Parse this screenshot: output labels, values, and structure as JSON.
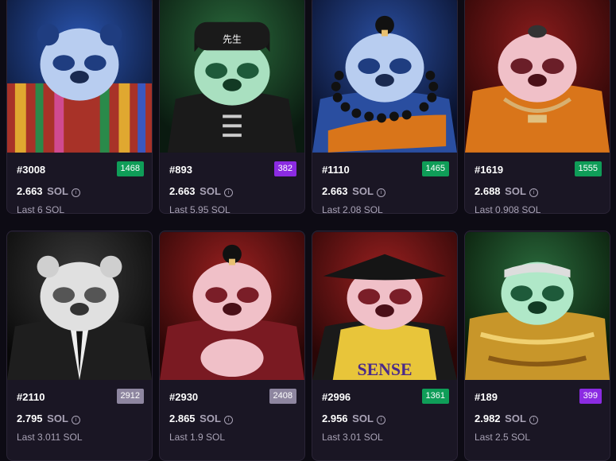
{
  "cards": [
    {
      "id": "#3008",
      "rank": "1468",
      "rank_color": "#0f9d58",
      "price": "2.663",
      "unit": "SOL",
      "last": "Last 6 SOL",
      "bg": "#1b3a7a",
      "fur": "#b8cdf0",
      "patch": "#1f3d80",
      "outfit": "#c0392b"
    },
    {
      "id": "#893",
      "rank": "382",
      "rank_color": "#8b2be2",
      "price": "2.663",
      "unit": "SOL",
      "last": "Last 5.95 SOL",
      "bg": "#1e4d2b",
      "fur": "#a9e0c0",
      "patch": "#1e5a3a",
      "outfit": "#1a1a1a"
    },
    {
      "id": "#1110",
      "rank": "1465",
      "rank_color": "#0f9d58",
      "price": "2.663",
      "unit": "SOL",
      "last": "Last 2.08 SOL",
      "bg": "#18306a",
      "fur": "#b8cdf0",
      "patch": "#1f3d80",
      "outfit": "#2a4ea0"
    },
    {
      "id": "#1619",
      "rank": "1555",
      "rank_color": "#0f9d58",
      "price": "2.688",
      "unit": "SOL",
      "last": "Last 0.908 SOL",
      "bg": "#5a1414",
      "fur": "#f0c0c8",
      "patch": "#6a1e28",
      "outfit": "#d9751a"
    },
    {
      "id": "#2110",
      "rank": "2912",
      "rank_color": "#8e86a0",
      "price": "2.795",
      "unit": "SOL",
      "last": "Last 3.011 SOL",
      "bg": "#2a2a2a",
      "fur": "#e0e0e0",
      "patch": "#555555",
      "outfit": "#222222"
    },
    {
      "id": "#2930",
      "rank": "2408",
      "rank_color": "#8e86a0",
      "price": "2.865",
      "unit": "SOL",
      "last": "Last 1.9 SOL",
      "bg": "#6a1414",
      "fur": "#f0c0c8",
      "patch": "#7a1e28",
      "outfit": "#7a1a22"
    },
    {
      "id": "#2996",
      "rank": "1361",
      "rank_color": "#0f9d58",
      "price": "2.956",
      "unit": "SOL",
      "last": "Last 3.01 SOL",
      "bg": "#6a1414",
      "fur": "#f0c0c8",
      "patch": "#7a1e28",
      "outfit": "#e8c53a",
      "shirt_text": "SENSE"
    },
    {
      "id": "#189",
      "rank": "399",
      "rank_color": "#8b2be2",
      "price": "2.982",
      "unit": "SOL",
      "last": "Last 2.5 SOL",
      "bg": "#1a4a2a",
      "fur": "#b0e8c8",
      "patch": "#1e5a3a",
      "outfit": "#c8962a"
    }
  ],
  "hat_text_893": "先生",
  "info_icon": "i"
}
